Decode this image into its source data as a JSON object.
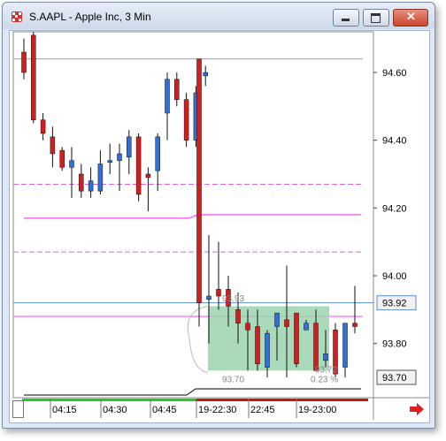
{
  "window": {
    "title": "S.AAPL - Apple Inc, 3 Min",
    "icon": "chart-app-icon",
    "buttons": [
      "minimize-icon",
      "maximize-icon",
      "close-icon"
    ]
  },
  "chart_data": {
    "type": "candlestick",
    "title": "",
    "y_axis": {
      "min": 93.64,
      "max": 94.72,
      "ticks": [
        "94.60",
        "94.40",
        "94.20",
        "94.00",
        "93.80"
      ],
      "tick_values": [
        94.6,
        94.4,
        94.2,
        94.0,
        93.8
      ]
    },
    "x_axis": {
      "labels": [
        "04:15",
        "04:30",
        "04:45",
        "19-22:30",
        "22:45",
        "19-23:00"
      ]
    },
    "price_boxes": [
      {
        "text": "93.92",
        "value": 93.92,
        "color": "#5b8fd0"
      },
      {
        "text": "93.70",
        "value": 93.7,
        "color": "#555555"
      }
    ],
    "colors": {
      "up": "#2f6fd6",
      "down": "#d11f1f",
      "bracket": "#9bd3ad",
      "guide": "#ff66ff",
      "price_line": "#5b8fd0"
    },
    "session_one": [
      {
        "o": 94.66,
        "h": 94.7,
        "l": 94.58,
        "c": 94.6
      },
      {
        "o": 94.71,
        "h": 94.72,
        "l": 94.45,
        "c": 94.46
      },
      {
        "o": 94.46,
        "h": 94.48,
        "l": 94.4,
        "c": 94.42
      },
      {
        "o": 94.41,
        "h": 94.44,
        "l": 94.32,
        "c": 94.36
      },
      {
        "o": 94.37,
        "h": 94.38,
        "l": 94.31,
        "c": 94.32
      },
      {
        "o": 94.32,
        "h": 94.38,
        "l": 94.23,
        "c": 94.34
      },
      {
        "o": 94.3,
        "h": 94.33,
        "l": 94.23,
        "c": 94.25
      },
      {
        "o": 94.25,
        "h": 94.32,
        "l": 94.23,
        "c": 94.28
      },
      {
        "o": 94.25,
        "h": 94.37,
        "l": 94.24,
        "c": 94.33
      },
      {
        "o": 94.34,
        "h": 94.39,
        "l": 94.3,
        "c": 94.34
      },
      {
        "o": 94.34,
        "h": 94.39,
        "l": 94.25,
        "c": 94.36
      },
      {
        "o": 94.35,
        "h": 94.43,
        "l": 94.3,
        "c": 94.41
      },
      {
        "o": 94.41,
        "h": 94.42,
        "l": 94.22,
        "c": 94.24
      },
      {
        "o": 94.3,
        "h": 94.32,
        "l": 94.19,
        "c": 94.29
      },
      {
        "o": 94.31,
        "h": 94.42,
        "l": 94.25,
        "c": 94.41
      },
      {
        "o": 94.48,
        "h": 94.6,
        "l": 94.4,
        "c": 94.58
      },
      {
        "o": 94.58,
        "h": 94.6,
        "l": 94.5,
        "c": 94.52
      },
      {
        "o": 94.52,
        "h": 94.54,
        "l": 94.38,
        "c": 94.4
      },
      {
        "o": 94.4,
        "h": 94.56,
        "l": 94.38,
        "c": 94.54
      },
      {
        "o": 94.59,
        "h": 94.62,
        "l": 94.56,
        "c": 94.6
      }
    ],
    "session_two": [
      {
        "o": 94.64,
        "h": 94.64,
        "l": 93.85,
        "c": 93.92
      },
      {
        "o": 93.93,
        "h": 94.12,
        "l": 93.8,
        "c": 93.94
      },
      {
        "o": 93.96,
        "h": 94.1,
        "l": 93.9,
        "c": 93.94
      },
      {
        "o": 93.96,
        "h": 94.0,
        "l": 93.85,
        "c": 93.91
      },
      {
        "o": 93.9,
        "h": 93.95,
        "l": 93.8,
        "c": 93.86
      },
      {
        "o": 93.86,
        "h": 93.9,
        "l": 93.72,
        "c": 93.84
      },
      {
        "o": 93.85,
        "h": 93.9,
        "l": 93.72,
        "c": 93.74
      },
      {
        "o": 93.73,
        "h": 93.84,
        "l": 93.7,
        "c": 93.83
      },
      {
        "o": 93.85,
        "h": 93.89,
        "l": 93.75,
        "c": 93.89
      },
      {
        "o": 93.87,
        "h": 94.03,
        "l": 93.7,
        "c": 93.85
      },
      {
        "o": 93.89,
        "h": 93.89,
        "l": 93.73,
        "c": 93.74
      },
      {
        "o": 93.84,
        "h": 93.87,
        "l": 93.84,
        "c": 93.86
      },
      {
        "o": 93.86,
        "h": 93.9,
        "l": 93.72,
        "c": 93.72
      },
      {
        "o": 93.75,
        "h": 93.84,
        "l": 93.73,
        "c": 93.77
      },
      {
        "o": 93.84,
        "h": 93.86,
        "l": 93.7,
        "c": 93.71
      },
      {
        "o": 93.73,
        "h": 93.86,
        "l": 93.7,
        "c": 93.86
      },
      {
        "o": 93.86,
        "h": 93.97,
        "l": 93.83,
        "c": 93.85
      }
    ],
    "levels": [
      {
        "value": 94.64,
        "color": "#aaaaaa"
      },
      {
        "value": 94.27,
        "color": "#dd66dd",
        "dash": true
      },
      {
        "value": 94.07,
        "color": "#dd66dd",
        "dash": true
      },
      {
        "value": 93.88,
        "color": "#ff66ff"
      }
    ],
    "bracket": {
      "top_value": 93.91,
      "bottom_value": 93.72,
      "target_label": "93.93",
      "stop_label": "93.70",
      "qty_label": "0.23 %",
      "extra_label": "93.72"
    }
  }
}
